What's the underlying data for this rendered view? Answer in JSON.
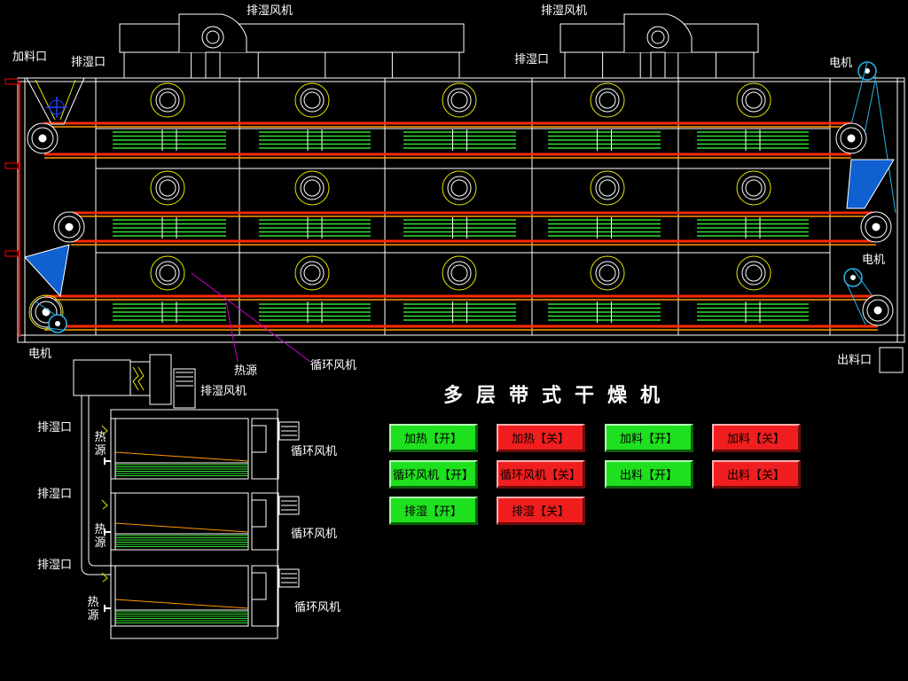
{
  "labels": {
    "exhaust_fan_top_left": "排湿风机",
    "exhaust_fan_top_right": "排湿风机",
    "feed_inlet": "加料口",
    "exhaust_port_top_left": "排湿口",
    "exhaust_port_top_right": "排湿口",
    "motor_top_right": "电机",
    "motor_mid_right": "电机",
    "motor_bottom_left": "电机",
    "heat_source": "热源",
    "circ_fan_main": "循环风机",
    "discharge_port": "出料口",
    "side_exhaust_fan": "排湿风机",
    "side_exhaust_port_1": "排湿口",
    "side_exhaust_port_2": "排湿口",
    "side_exhaust_port_3": "排湿口",
    "side_heat_1": "热源",
    "side_heat_2": "热源",
    "side_heat_3": "热源",
    "side_circ_fan_1": "循环风机",
    "side_circ_fan_2": "循环风机",
    "side_circ_fan_3": "循环风机"
  },
  "title": "多层带式干燥机",
  "buttons": {
    "heat_on": "加热【开】",
    "heat_off": "加热【关】",
    "feed_on": "加料【开】",
    "feed_off": "加料【关】",
    "circ_fan_on": "循环风机【开】",
    "circ_fan_off": "循环风机【关】",
    "discharge_on": "出料【开】",
    "discharge_off": "出料【关】",
    "exhaust_on": "排湿【开】",
    "exhaust_off": "排湿【关】"
  },
  "colors": {
    "on": "#1ee01e",
    "off": "#f01e1e",
    "frame": "#ffffff",
    "belt_red": "#ff2a00",
    "belt_orange": "#ff9900",
    "heater_coil": "#33dd33",
    "fan_ring": "#e6e600",
    "hopper": "#1060d0",
    "drive_line": "#28b4e6",
    "annotation": "#cc00cc"
  }
}
